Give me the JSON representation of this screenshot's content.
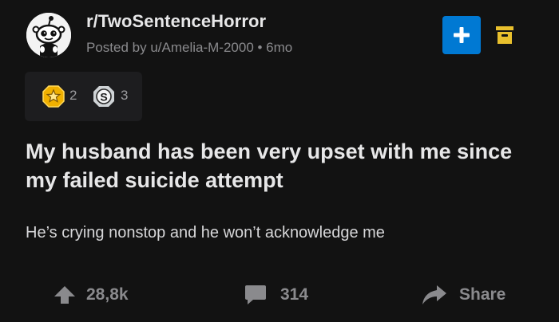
{
  "post": {
    "subreddit": "r/TwoSentenceHorror",
    "meta": "Posted by u/Amelia-M-2000 • 6mo",
    "title": "My husband has been very upset with me since my failed suicide attempt",
    "body": "He’s crying nonstop and he won’t acknowledge me"
  },
  "awards": [
    {
      "icon": "gold-award-icon",
      "count": "2"
    },
    {
      "icon": "silver-award-icon",
      "count": "3"
    }
  ],
  "actions": {
    "upvotes": "28,8k",
    "comments": "314",
    "share": "Share"
  },
  "colors": {
    "background": "#121212",
    "accent": "#0079d3",
    "archive": "#e9c02d",
    "muted": "#8a8a8d"
  }
}
